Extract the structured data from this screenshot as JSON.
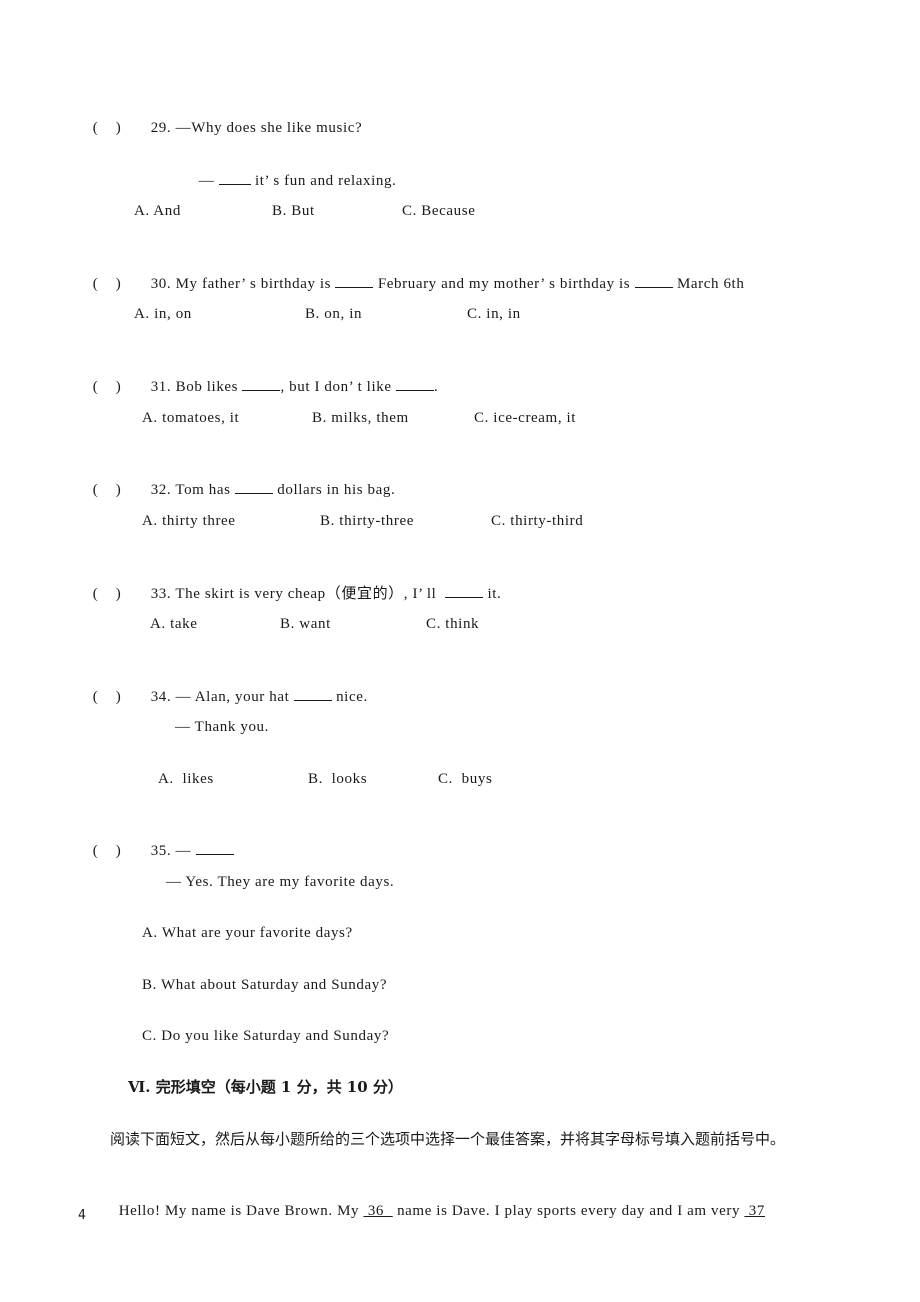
{
  "page_number": "4",
  "questions": [
    {
      "paren": "(    )",
      "number": "29.",
      "stem_pre": "—Why does she like music?",
      "reply_pre": "— ",
      "reply_post": " it’ s fun and relaxing.",
      "options": [
        "A. And",
        "B. But",
        "C. Because"
      ]
    },
    {
      "paren": "(    )",
      "number": "30.",
      "stem_a": "My father’ s birthday is ",
      "stem_b": " February and my mother’ s birthday is ",
      "stem_c": " March 6th",
      "options": [
        "A. in, on",
        "B. on, in",
        "C. in, in"
      ]
    },
    {
      "paren": "(    )",
      "number": "31.",
      "stem_a": "Bob likes ",
      "stem_b": ", but I don’ t like ",
      "stem_c": ".",
      "options": [
        "A. tomatoes, it",
        "B. milks, them",
        "C. ice-cream, it"
      ]
    },
    {
      "paren": "(    )",
      "number": "32.",
      "stem_a": "Tom has ",
      "stem_b": " dollars in his bag.",
      "options": [
        "A. thirty three",
        "B. thirty-three",
        "C. thirty-third"
      ]
    },
    {
      "paren": "(    )",
      "number": "33.",
      "stem_a": "The skirt is very cheap（便宜的）, I’ ll  ",
      "stem_b": " it.",
      "options": [
        "A. take",
        "B. want",
        "C. think"
      ]
    },
    {
      "paren": "(    )",
      "number": "34.",
      "stem_a": "— Alan, your hat ",
      "stem_b": " nice.",
      "reply": "— Thank you.",
      "options": [
        "A.  likes",
        "B.  looks",
        "C.  buys"
      ]
    },
    {
      "paren": "(    )",
      "number": "35.",
      "stem_a": "— ",
      "reply": "— Yes. They are my favorite days.",
      "options": [
        "A. What are your favorite days?",
        "B. What about Saturday and Sunday?",
        "C. Do you like Saturday and Sunday?"
      ]
    }
  ],
  "section": {
    "title": "Ⅵ. 完形填空（每小题 1 分，共 10 分）",
    "instruction": "阅读下面短文，然后从每小题所给的三个选项中选择一个最佳答案，并将其字母标号填入题前括号中。",
    "passage_a": "Hello! My name is Dave Brown. My ",
    "blank_36": " 36  ",
    "passage_b": " name is Dave. I play sports every day and I am very ",
    "blank_37": " 37"
  }
}
